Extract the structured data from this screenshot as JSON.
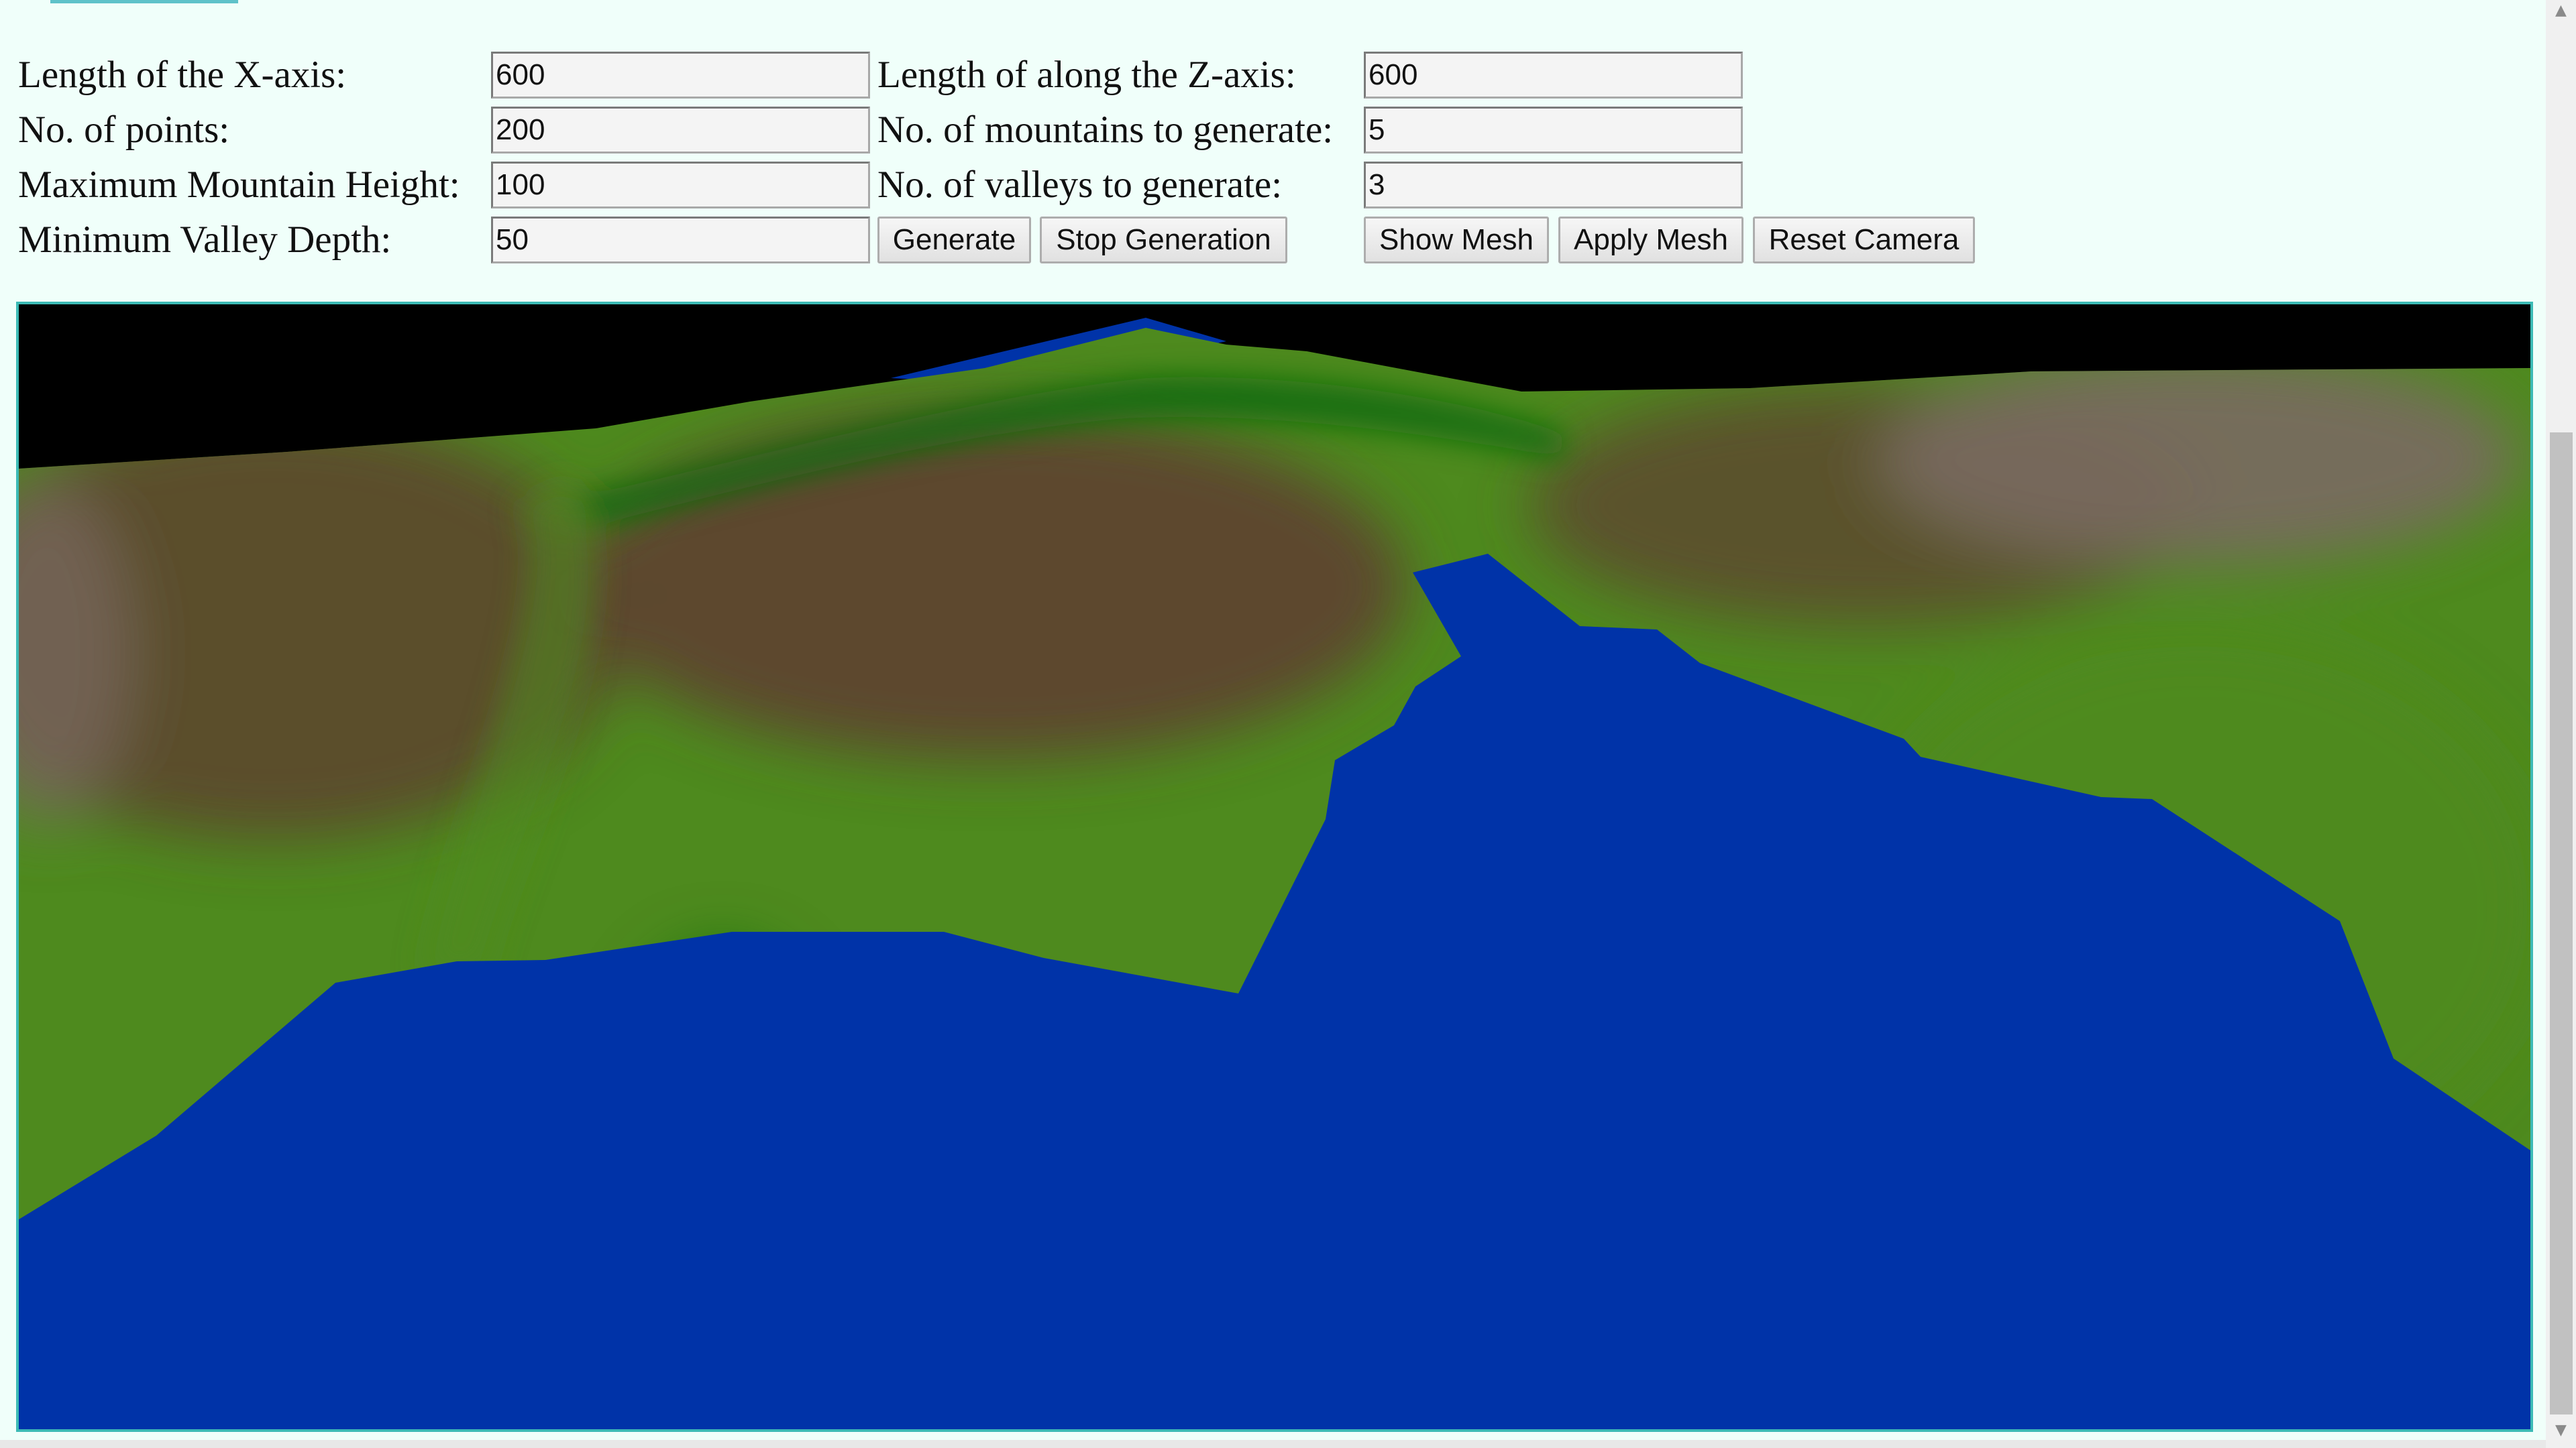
{
  "form": {
    "x_axis_label": "Length of the X-axis:",
    "x_axis_value": "600",
    "z_axis_label": "Length of along the Z-axis:",
    "z_axis_value": "600",
    "points_label": "No. of points:",
    "points_value": "200",
    "mountains_label": "No. of mountains to generate:",
    "mountains_value": "5",
    "max_height_label": "Maximum Mountain Height:",
    "max_height_value": "100",
    "valleys_label": "No. of valleys to generate:",
    "valleys_value": "3",
    "min_depth_label": "Minimum Valley Depth:",
    "min_depth_value": "50"
  },
  "buttons": {
    "generate": "Generate",
    "stop_generation": "Stop Generation",
    "show_mesh": "Show Mesh",
    "apply_mesh": "Apply Mesh",
    "reset_camera": "Reset Camera"
  },
  "scene": {
    "sky_color": "#000000",
    "water_color": "#0033a8",
    "grass_color": "#4e8a1e",
    "forest_color": "#0a6a10",
    "rock_color": "#5e4330",
    "peak_color": "#7a6a62"
  },
  "icons": {
    "scroll_up": "scroll-up-arrow-icon",
    "scroll_down": "scroll-down-arrow-icon"
  }
}
